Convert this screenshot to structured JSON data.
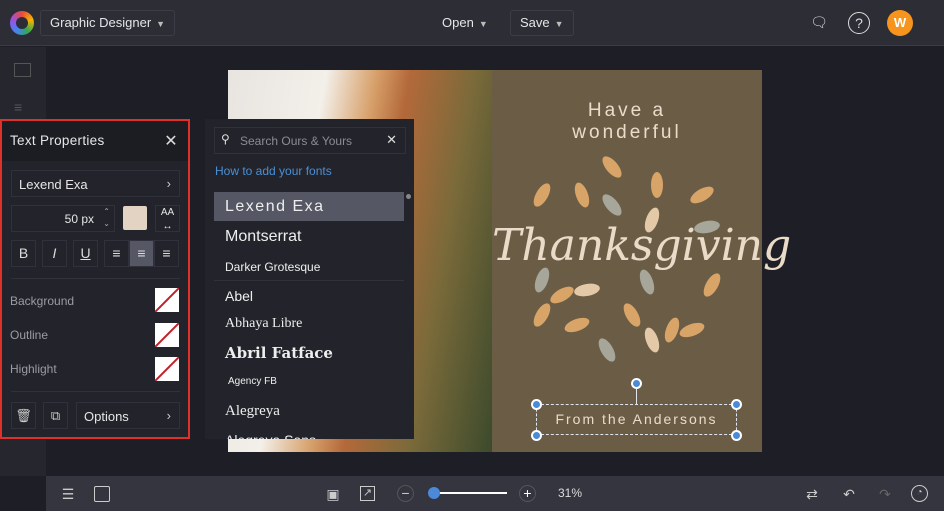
{
  "topbar": {
    "project": "Graphic Designer",
    "open": "Open",
    "save": "Save",
    "avatar": "W"
  },
  "panel": {
    "title": "Text Properties",
    "font": "Lexend Exa",
    "size": "50 px",
    "aa": "AA",
    "bold": "B",
    "italic": "I",
    "underline": "U",
    "background": "Background",
    "outline": "Outline",
    "highlight": "Highlight",
    "options": "Options",
    "text_color": "#e3d3c3"
  },
  "fontpicker": {
    "search_placeholder": "Search Ours & Yours",
    "howto": "How to add your fonts",
    "fonts": [
      "Lexend Exa",
      "Montserrat",
      "Darker Grotesque",
      "Abel",
      "Abhaya Libre",
      "Abril Fatface",
      "Agency FB",
      "Alegreya",
      "Alegreya Sans"
    ]
  },
  "card": {
    "line1": "Have a",
    "line2": "wonderful",
    "title": "Thanksgiving",
    "footer": "From the Andersons"
  },
  "bottombar": {
    "zoom": "31%",
    "zoom_fraction": 0.05
  }
}
